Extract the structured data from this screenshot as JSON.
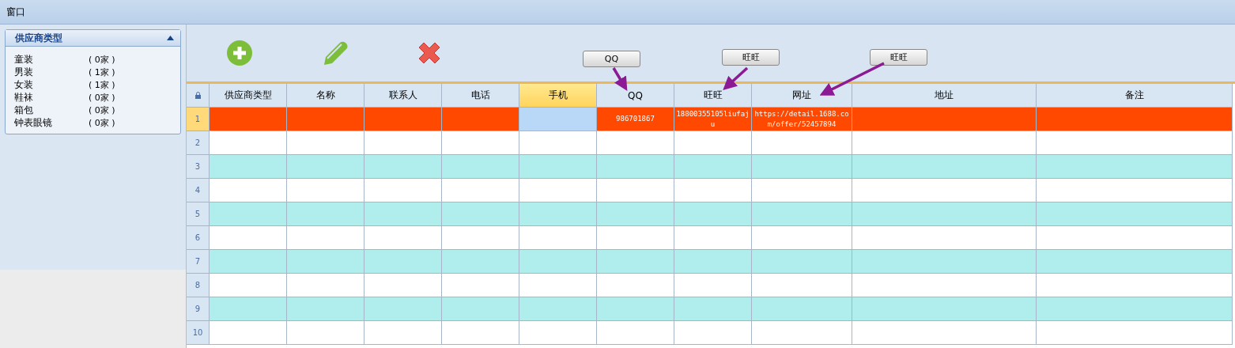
{
  "window": {
    "title": "窗口"
  },
  "sidebar": {
    "title": "供应商类型",
    "expanded": true,
    "items": [
      {
        "name": "童装",
        "count": "( 0家 )"
      },
      {
        "name": "男装",
        "count": "( 1家 )"
      },
      {
        "name": "女装",
        "count": "( 1家 )"
      },
      {
        "name": "鞋袜",
        "count": "( 0家 )"
      },
      {
        "name": "箱包",
        "count": "( 0家 )"
      },
      {
        "name": "钟表眼镜",
        "count": "( 0家 )"
      }
    ]
  },
  "toolbar": {
    "callouts": [
      {
        "label": "QQ"
      },
      {
        "label": "旺旺"
      },
      {
        "label": "旺旺"
      }
    ]
  },
  "table": {
    "columns": [
      {
        "label": "供应商类型",
        "selected": false
      },
      {
        "label": "名称",
        "selected": false
      },
      {
        "label": "联系人",
        "selected": false
      },
      {
        "label": "电话",
        "selected": false
      },
      {
        "label": "手机",
        "selected": true
      },
      {
        "label": "QQ",
        "selected": false
      },
      {
        "label": "旺旺",
        "selected": false
      },
      {
        "label": "网址",
        "selected": false
      },
      {
        "label": "地址",
        "selected": false
      },
      {
        "label": "备注",
        "selected": false
      }
    ],
    "rows": [
      {
        "number": "1",
        "selected": true,
        "cells": [
          "",
          "",
          "",
          "",
          "",
          "986701867",
          "18800355105liufaju",
          "https://detail.1688.com/offer/52457894",
          "",
          ""
        ]
      },
      {
        "number": "2",
        "selected": false
      },
      {
        "number": "3",
        "selected": false
      },
      {
        "number": "4",
        "selected": false
      },
      {
        "number": "5",
        "selected": false
      },
      {
        "number": "6",
        "selected": false
      },
      {
        "number": "7",
        "selected": false
      },
      {
        "number": "8",
        "selected": false
      },
      {
        "number": "9",
        "selected": false
      },
      {
        "number": "10",
        "selected": false
      }
    ]
  }
}
